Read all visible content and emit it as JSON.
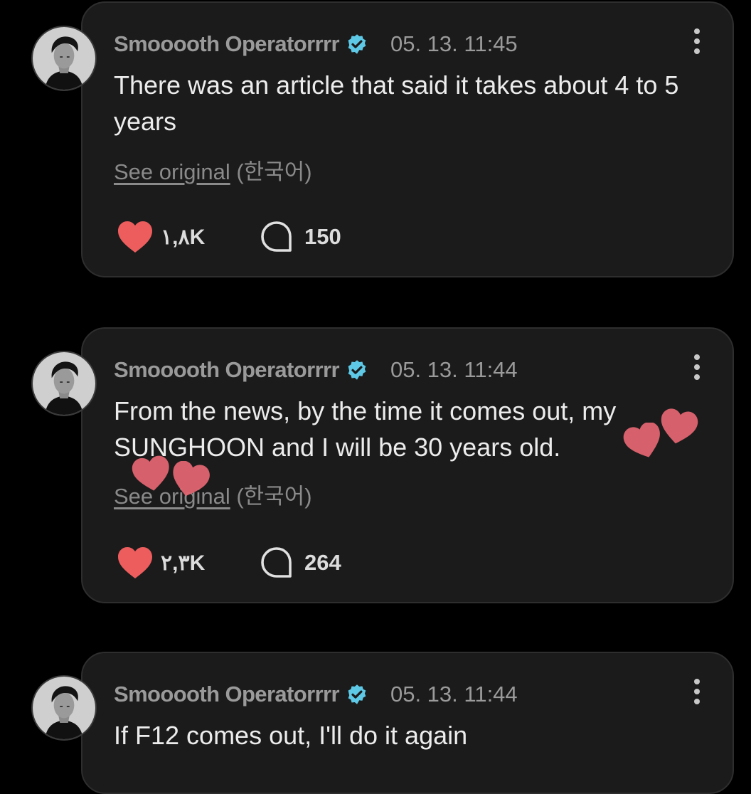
{
  "colors": {
    "background": "#000000",
    "card": "#1b1b1b",
    "heart": "#ee5d5d",
    "floating_heart": "#e06470",
    "verified_badge": "#5ec9e6"
  },
  "comments": [
    {
      "username": "Smooooth Operatorrrr",
      "verified_icon": "verified-check-icon",
      "timestamp": "05. 13. 11:45",
      "text": "There was an article that said it takes about 4 to 5 years",
      "see_original": "See original",
      "language": "(한국어)",
      "likes": "١,٨K",
      "replies": "150"
    },
    {
      "username": "Smooooth Operatorrrr",
      "verified_icon": "verified-check-icon",
      "timestamp": "05. 13. 11:44",
      "text": "From the news, by the time it comes out, my SUNGHOON and I will be 30 years old.",
      "see_original": "See original",
      "language": "(한국어)",
      "likes": "٢,٣K",
      "replies": "264"
    },
    {
      "username": "Smooooth Operatorrrr",
      "verified_icon": "verified-check-icon",
      "timestamp": "05. 13. 11:44",
      "text": "If F12 comes out, I'll do it again"
    }
  ]
}
